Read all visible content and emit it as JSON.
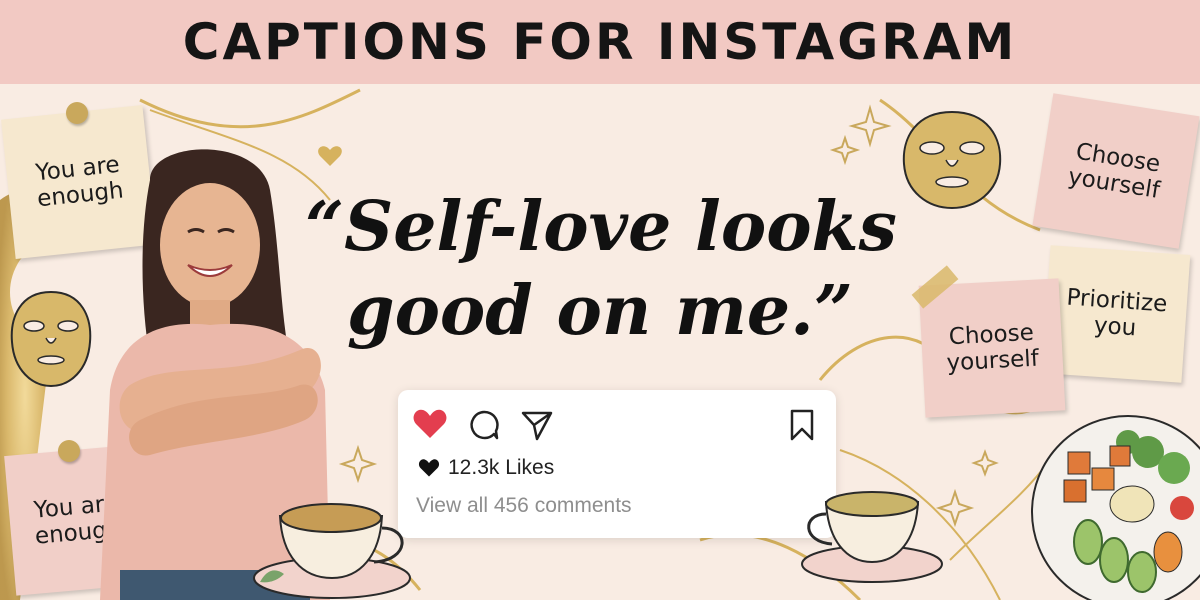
{
  "header": {
    "title": "CAPTIONS FOR INSTAGRAM"
  },
  "quote": {
    "line1": "“Self-love looks",
    "line2": "good on me.”"
  },
  "notes": [
    {
      "line1": "You are",
      "line2": "enough"
    },
    {
      "line1": "You are",
      "line2": "enough"
    },
    {
      "line1": "Choose",
      "line2": "yourself"
    },
    {
      "line1": "Prioritize",
      "line2": "you"
    },
    {
      "line1": "Choose",
      "line2": "yourself"
    }
  ],
  "post": {
    "likes": "12.3k Likes",
    "comments": "View all 456 comments"
  },
  "icons": {
    "like": "heart-icon",
    "comment": "comment-icon",
    "share": "send-icon",
    "save": "bookmark-icon",
    "likes_count": "heart-small-icon"
  },
  "colors": {
    "banner": "#f2c9c3",
    "background": "#f9ece3",
    "gold": "#d6b25e",
    "heart": "#e33e4f",
    "note_cream": "#f6e8cf",
    "note_pink": "#f1cfc8"
  }
}
